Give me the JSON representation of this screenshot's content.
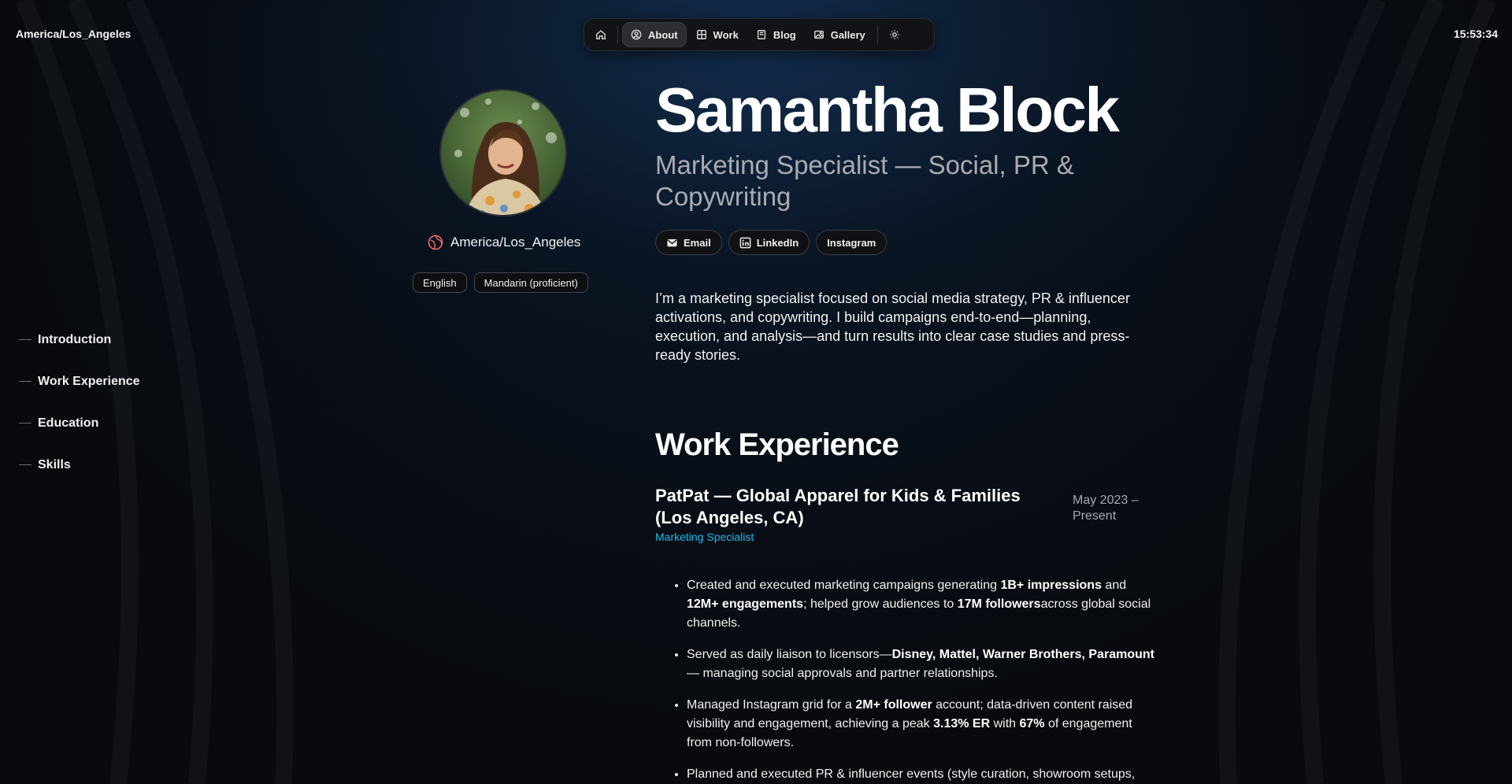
{
  "topbar": {
    "timezone": "America/Los_Angeles",
    "clock": "15:53:34"
  },
  "nav": {
    "items": [
      {
        "label": "About",
        "icon": "person-circle-icon",
        "active": true
      },
      {
        "label": "Work",
        "icon": "grid-icon"
      },
      {
        "label": "Blog",
        "icon": "book-icon"
      },
      {
        "label": "Gallery",
        "icon": "image-icon"
      }
    ]
  },
  "toc": [
    "Introduction",
    "Work Experience",
    "Education",
    "Skills"
  ],
  "profile": {
    "location": "America/Los_Angeles",
    "languages": [
      "English",
      "Mandarin (proficient)"
    ]
  },
  "header": {
    "name": "Samantha Block",
    "role": "Marketing Specialist — Social, PR & Copywriting"
  },
  "links": [
    "Email",
    "LinkedIn",
    "Instagram"
  ],
  "intro": "I’m a marketing specialist focused on social media strategy, PR & influencer activations, and copywriting. I build campaigns end-to-end—planning, execution, and analysis—and turn results into clear case studies and press-ready stories.",
  "work": {
    "heading": "Work Experience",
    "jobs": [
      {
        "company": "PatPat — Global Apparel for Kids & Families (Los Angeles, CA)",
        "dates": "May 2023 – Present",
        "role": "Marketing Specialist",
        "bullets": [
          [
            {
              "t": "Created and executed marketing campaigns generating "
            },
            {
              "t": "1B+ impressions",
              "b": true
            },
            {
              "t": " and "
            },
            {
              "t": "12M+ engagements",
              "b": true
            },
            {
              "t": "; helped grow audiences to "
            },
            {
              "t": "17M followers",
              "b": true
            },
            {
              "t": "across global social channels."
            }
          ],
          [
            {
              "t": "Served as daily liaison to licensors—"
            },
            {
              "t": "Disney, Mattel, Warner Brothers, Paramount",
              "b": true
            },
            {
              "t": "— managing social approvals and partner relationships."
            }
          ],
          [
            {
              "t": "Managed Instagram grid for a "
            },
            {
              "t": "2M+ follower",
              "b": true
            },
            {
              "t": " account; data-driven content raised visibility and engagement, achieving a peak "
            },
            {
              "t": "3.13% ER",
              "b": true
            },
            {
              "t": " with "
            },
            {
              "t": "67%",
              "b": true
            },
            {
              "t": " of engagement from non-followers."
            }
          ],
          [
            {
              "t": "Planned and executed PR & influencer events (style curation, showroom setups,"
            }
          ]
        ]
      }
    ]
  },
  "colors": {
    "accent": "#1fb6e8",
    "background": "#0b0b0d"
  }
}
